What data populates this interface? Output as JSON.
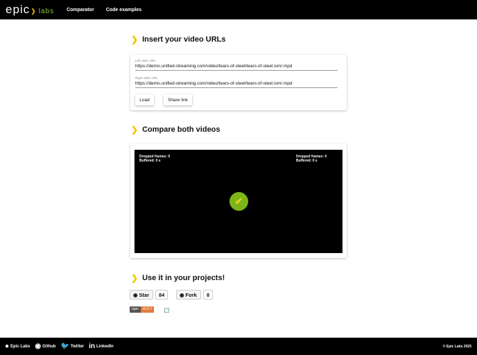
{
  "header": {
    "logo_main": "epic",
    "logo_sub": "labs",
    "nav": [
      "Comparator",
      "Code examples"
    ]
  },
  "insert": {
    "title": "Insert your video URLs",
    "left_label": "Left video URL",
    "left_value": "https://demo.unified-streaming.com/video/tears-of-steel/tears-of-steel.ism/.mpd",
    "right_label": "Right video URL",
    "right_value": "https://demo.unified-streaming.com/video/tears-of-steel/tears-of-steel.ism/.mpd",
    "load": "Load",
    "share": "Share link"
  },
  "compare": {
    "title": "Compare both videos",
    "left_dropped": "Dropped frames: 0",
    "left_buffered": "Buffered: 0 s",
    "right_dropped": "Dropped frames: 0",
    "right_buffered": "Buffered: 0 s"
  },
  "projects": {
    "title": "Use it in your projects!",
    "star": "Star",
    "star_count": "84",
    "fork": "Fork",
    "fork_count": "8",
    "npm_label": "npm",
    "npm_version": "v0.0.7"
  },
  "footer": {
    "links": [
      "Epic Labs",
      "Github",
      "Twitter",
      "LinkedIn"
    ],
    "copyright": "© Epic Labs 2025"
  }
}
